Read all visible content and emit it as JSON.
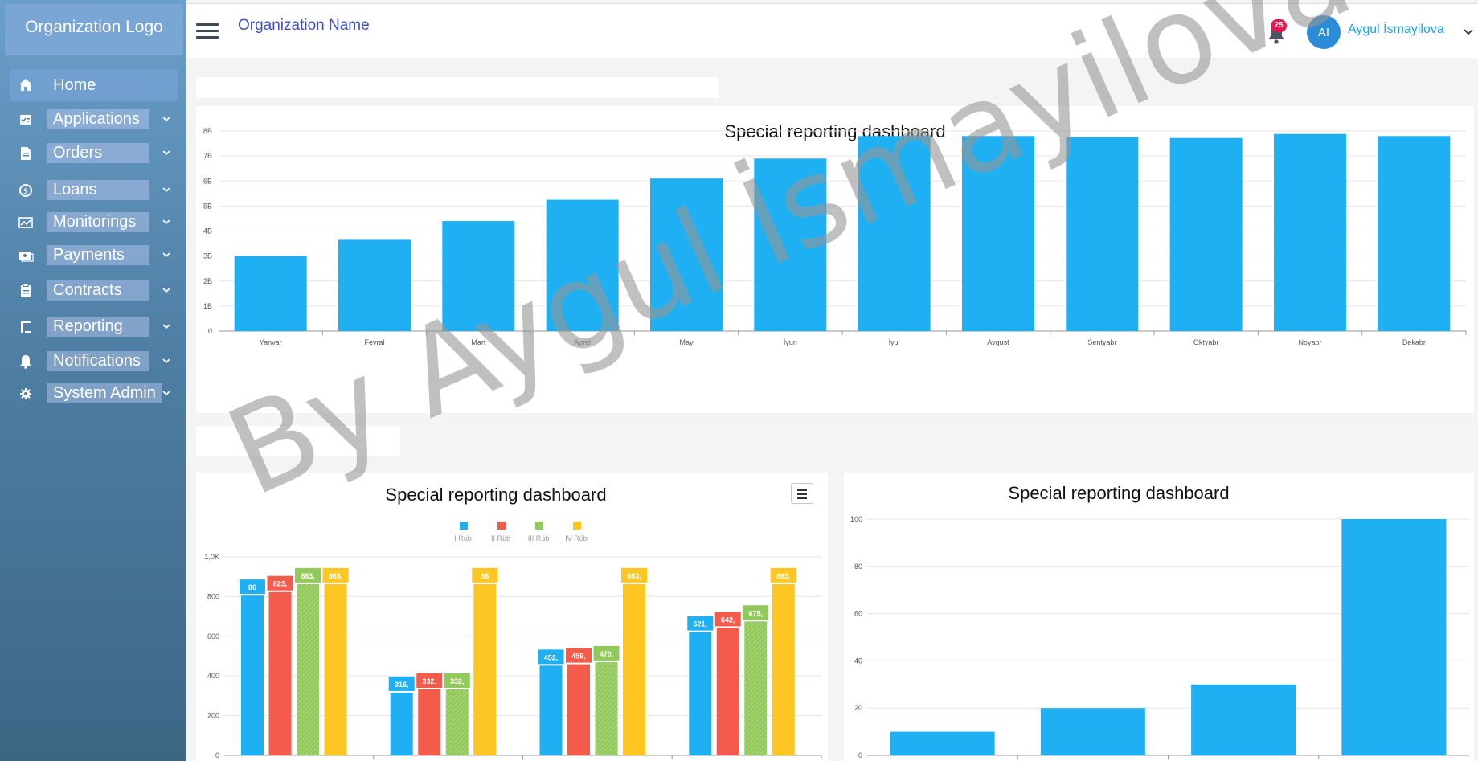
{
  "sidebar": {
    "logo": "Organization Logo",
    "items": [
      {
        "label": "Home",
        "icon": "home-icon"
      },
      {
        "label": "Applications",
        "icon": "checklist-icon"
      },
      {
        "label": "Orders",
        "icon": "document-icon"
      },
      {
        "label": "Loans",
        "icon": "loan-icon"
      },
      {
        "label": "Monitorings",
        "icon": "monitor-chart-icon"
      },
      {
        "label": "Payments",
        "icon": "payment-icon"
      },
      {
        "label": "Contracts",
        "icon": "clipboard-icon"
      },
      {
        "label": "Reporting",
        "icon": "report-icon"
      },
      {
        "label": "Notifications",
        "icon": "bell-icon"
      },
      {
        "label": "System Admin",
        "icon": "gear-icon"
      }
    ]
  },
  "header": {
    "org_name": "Organization Name",
    "notification_count": "25",
    "avatar_initials": "AI",
    "user_name": "Aygul İsmayilova"
  },
  "watermark": "By Aygul İsmayilova",
  "colors": {
    "blue": "#1eb0f3",
    "red": "#f45b4b",
    "green": "#91c95a",
    "yellow": "#fdc623"
  },
  "charts": {
    "top_title": "Special reporting dashboard",
    "bottom_left_title": "Special reporting dashboard",
    "bottom_right_title": "Special reporting dashboard"
  },
  "chart_data": [
    {
      "type": "bar",
      "title": "Special reporting dashboard",
      "categories": [
        "Yanvar",
        "Fevral",
        "Mart",
        "Aprel",
        "May",
        "İyun",
        "İyul",
        "Avqust",
        "Sentyabr",
        "Oktyabr",
        "Noyabr",
        "Dekabr"
      ],
      "values": [
        3.0,
        3.65,
        4.4,
        5.25,
        6.1,
        6.9,
        7.8,
        7.8,
        7.75,
        7.72,
        7.88,
        7.8
      ],
      "yticks": [
        "0",
        "1B",
        "2B",
        "3B",
        "4B",
        "5B",
        "6B",
        "7B",
        "8B"
      ],
      "ylim": [
        0,
        8
      ],
      "grid": true
    },
    {
      "type": "bar",
      "title": "Special reporting dashboard",
      "legend": [
        "I Rüb",
        "II Rüb",
        "III Rüb",
        "IV Rüb"
      ],
      "series": [
        {
          "name": "I Rüb",
          "values": [
            805,
            316,
            452,
            621
          ],
          "labels": [
            "80",
            "316,",
            "452,",
            "621,"
          ]
        },
        {
          "name": "II Rüb",
          "values": [
            823,
            332,
            459,
            642
          ],
          "labels": [
            "823,",
            "332,",
            "459,",
            "642,"
          ]
        },
        {
          "name": "III Rüb",
          "values": [
            863,
            332,
            470,
            675
          ],
          "labels": [
            "863,",
            "332,",
            "470,",
            "675,"
          ]
        },
        {
          "name": "IV Rüb",
          "values": [
            863,
            863,
            863,
            863
          ],
          "labels": [
            "863,",
            "86",
            "863,",
            "863,"
          ]
        }
      ],
      "yticks": [
        "0",
        "200",
        "400",
        "600",
        "800",
        "1,0K"
      ],
      "ylim": [
        0,
        1000
      ],
      "grid": true
    },
    {
      "type": "bar",
      "title": "Special reporting dashboard",
      "values": [
        10,
        20,
        30,
        100
      ],
      "yticks": [
        "0",
        "20",
        "40",
        "60",
        "80",
        "100"
      ],
      "ylim": [
        0,
        100
      ],
      "grid": true
    }
  ]
}
